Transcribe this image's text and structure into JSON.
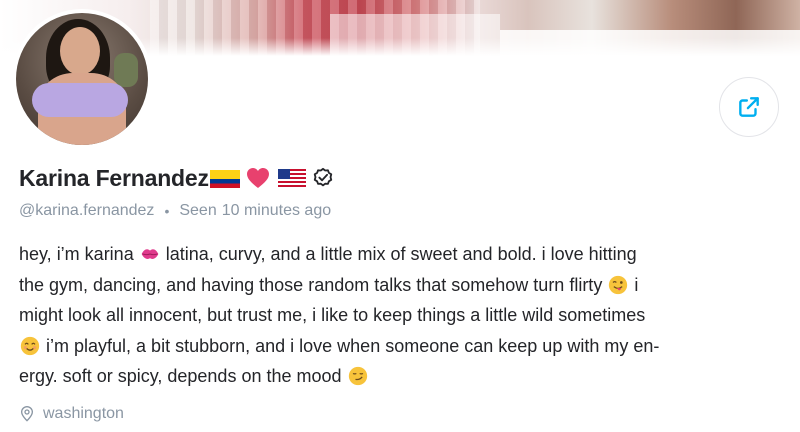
{
  "profile": {
    "name": "Karina Fernandez",
    "username": "@karina.fernandez",
    "seen_label": "Seen",
    "seen_value": "10 minutes ago",
    "separator": "•",
    "location": "washington",
    "name_badges": [
      "colombia-flag-icon",
      "pink-heart-icon",
      "us-flag-icon",
      "verified-badge-icon"
    ]
  },
  "bio": {
    "line1_a": "hey, i’m karina",
    "line1_b": "latina, curvy, and a little mix of sweet and bold. i love hitting",
    "line2_a": "the gym, dancing, and having those random talks that somehow turn flirty",
    "line2_b": "i",
    "line3": "might look all innocent, but trust me, i like to keep things a little wild sometimes",
    "line4": "i’m playful, a bit stubborn, and i love when someone can keep up with my en-",
    "line5": "ergy. soft or spicy, depends on the mood"
  },
  "icons": {
    "share": "share-icon",
    "location": "location-pin-icon",
    "bio_emojis": [
      "kiss-lips-icon",
      "tongue-out-wink-icon",
      "smiling-face-icon",
      "smirk-face-icon"
    ]
  },
  "colors": {
    "accent": "#00aff0",
    "text": "#242529",
    "muted": "#8a96a3",
    "heart": "#e8416e"
  }
}
